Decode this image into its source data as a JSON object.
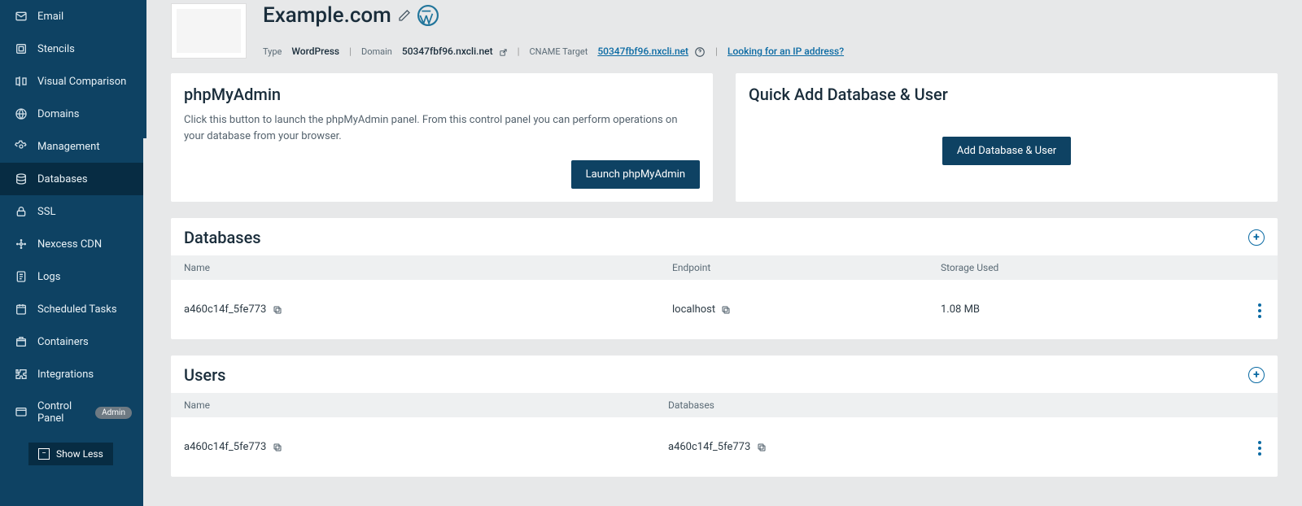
{
  "sidebar": {
    "items": [
      {
        "label": "Email",
        "name": "email"
      },
      {
        "label": "Stencils",
        "name": "stencils"
      },
      {
        "label": "Visual Comparison",
        "name": "visual-comparison"
      },
      {
        "label": "Domains",
        "name": "domains"
      },
      {
        "label": "Management",
        "name": "management"
      },
      {
        "label": "Databases",
        "name": "databases",
        "active": true
      },
      {
        "label": "SSL",
        "name": "ssl"
      },
      {
        "label": "Nexcess CDN",
        "name": "nexcess-cdn"
      },
      {
        "label": "Logs",
        "name": "logs"
      },
      {
        "label": "Scheduled Tasks",
        "name": "scheduled-tasks"
      },
      {
        "label": "Containers",
        "name": "containers"
      },
      {
        "label": "Integrations",
        "name": "integrations"
      },
      {
        "label": "Control Panel",
        "name": "control-panel",
        "badge": "Admin"
      }
    ],
    "show_less": "Show Less"
  },
  "header": {
    "title": "Example.com",
    "type_label": "Type",
    "type_value": "WordPress",
    "domain_label": "Domain",
    "domain_value": "50347fbf96.nxcli.net",
    "cname_label": "CNAME Target",
    "cname_value": "50347fbf96.nxcli.net",
    "ip_link": "Looking for an IP address?"
  },
  "phpmyadmin": {
    "title": "phpMyAdmin",
    "body": "Click this button to launch the phpMyAdmin panel. From this control panel you can perform operations on your database from your browser.",
    "button": "Launch phpMyAdmin"
  },
  "quickadd": {
    "title": "Quick Add Database & User",
    "button": "Add Database & User"
  },
  "databases": {
    "title": "Databases",
    "cols": {
      "name": "Name",
      "endpoint": "Endpoint",
      "storage": "Storage Used"
    },
    "rows": [
      {
        "name": "a460c14f_5fe773",
        "endpoint": "localhost",
        "storage": "1.08 MB"
      }
    ]
  },
  "users": {
    "title": "Users",
    "cols": {
      "name": "Name",
      "databases": "Databases"
    },
    "rows": [
      {
        "name": "a460c14f_5fe773",
        "db": "a460c14f_5fe773"
      }
    ]
  }
}
